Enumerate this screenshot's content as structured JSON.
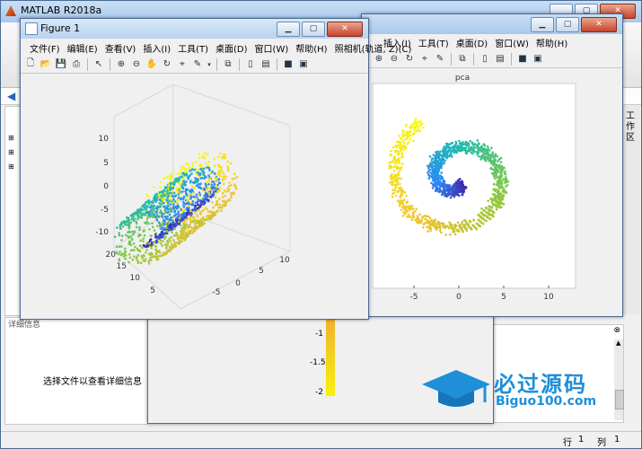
{
  "matlab_window": {
    "title": "MATLAB R2018a",
    "right_side_label": "工作区"
  },
  "detail_panel": {
    "header": "详细信息",
    "placeholder": "选择文件以查看详细信息"
  },
  "status_bar": {
    "row_label": "行",
    "row_value": "1",
    "col_label": "列",
    "col_value": "1"
  },
  "back_figure": {
    "y_ticks": [
      "-1",
      "-1.5",
      "-2"
    ]
  },
  "figure1": {
    "title": "Figure 1",
    "menu": [
      "文件(F)",
      "编辑(E)",
      "查看(V)",
      "插入(I)",
      "工具(T)",
      "桌面(D)",
      "窗口(W)",
      "帮助(H)",
      "照相机(轨道, Z)(C)"
    ],
    "z_ticks": [
      "10",
      "5",
      "0",
      "-5",
      "-10"
    ],
    "y_ticks": [
      "20",
      "15",
      "10",
      "5"
    ],
    "x_ticks": [
      "-5",
      "0",
      "5",
      "10"
    ]
  },
  "figure2": {
    "menu": [
      "插入(I)",
      "工具(T)",
      "桌面(D)",
      "窗口(W)",
      "帮助(H)"
    ],
    "plot_title": "pca",
    "x_ticks": [
      "-5",
      "0",
      "5",
      "10"
    ]
  },
  "watermark": {
    "name": "必过源码",
    "url": "Biguo100.com"
  },
  "icons": {
    "zoom_in": "zoom-in-icon",
    "zoom_out": "zoom-out-icon",
    "pan": "pan-icon",
    "rotate": "rotate-icon",
    "data_cursor": "data-cursor-icon",
    "brush": "brush-icon"
  },
  "colors": {
    "colormap": [
      "#3e26a8",
      "#2e87f6",
      "#1cbdb0",
      "#8ac83e",
      "#f1c232",
      "#f8fa0d"
    ],
    "plot_bg": "#ffffff",
    "figure_bg": "#f0f0f0"
  }
}
